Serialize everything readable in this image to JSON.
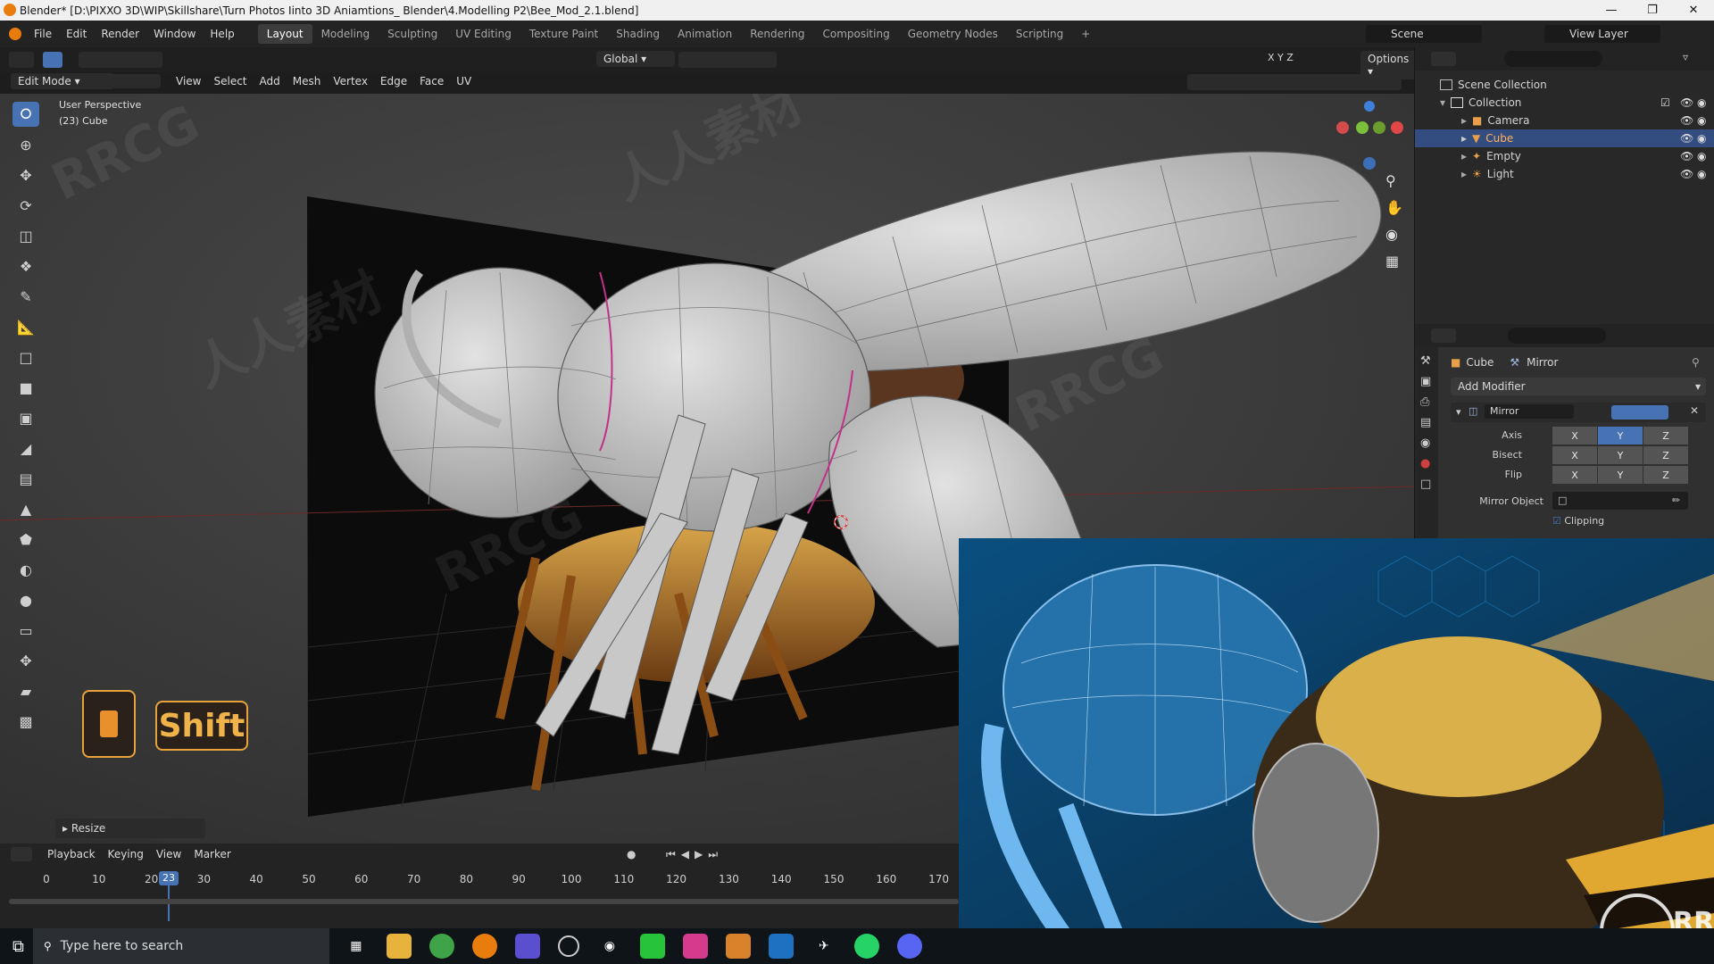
{
  "window": {
    "title": "Blender* [D:\\PIXXO 3D\\WIP\\Skillshare\\Turn Photos Iinto 3D Aniamtions_ Blender\\4.Modelling P2\\Bee_Mod_2.1.blend]"
  },
  "menubar": {
    "items": [
      "File",
      "Edit",
      "Render",
      "Window",
      "Help"
    ],
    "workspaces": [
      "Layout",
      "Modeling",
      "Sculpting",
      "UV Editing",
      "Texture Paint",
      "Shading",
      "Animation",
      "Rendering",
      "Compositing",
      "Geometry Nodes",
      "Scripting"
    ],
    "active_workspace": "Layout",
    "scene_label": "Scene",
    "view_layer_label": "View Layer"
  },
  "viewport_header": {
    "transform_orientation": "Global",
    "options_label": "Options",
    "mode": "Edit Mode",
    "menus": [
      "View",
      "Select",
      "Add",
      "Mesh",
      "Vertex",
      "Edge",
      "Face",
      "UV"
    ],
    "axis_x": "X",
    "axis_y": "Y",
    "axis_z": "Z"
  },
  "viewport": {
    "perspective": "User Perspective",
    "object_info": "(23) Cube",
    "gizmo_labels": {
      "x": "X",
      "y": "Y",
      "z": "Z"
    },
    "key_hint": "Shift",
    "operator_panel": "Resize"
  },
  "outliner": {
    "root": "Scene Collection",
    "collection": "Collection",
    "items": [
      {
        "label": "Camera",
        "selected": false
      },
      {
        "label": "Cube",
        "selected": true
      },
      {
        "label": "Empty",
        "selected": false
      },
      {
        "label": "Light",
        "selected": false
      }
    ]
  },
  "properties": {
    "object_name": "Cube",
    "modifier_breadcrumb": "Mirror",
    "add_modifier_label": "Add Modifier",
    "modifier_name": "Mirror",
    "rows": [
      {
        "label": "Axis",
        "x": "X",
        "y": "Y",
        "z": "Z",
        "active": "Y"
      },
      {
        "label": "Bisect",
        "x": "X",
        "y": "Y",
        "z": "Z",
        "active": ""
      },
      {
        "label": "Flip",
        "x": "X",
        "y": "Y",
        "z": "Z",
        "active": ""
      }
    ],
    "mirror_object_label": "Mirror Object",
    "clipping_label": "Clipping"
  },
  "timeline": {
    "menus": [
      "Playback",
      "Keying",
      "View",
      "Marker"
    ],
    "current_frame": "23",
    "ticks": [
      "0",
      "10",
      "20",
      "30",
      "40",
      "50",
      "60",
      "70",
      "80",
      "90",
      "100",
      "110",
      "120",
      "130",
      "140",
      "150",
      "160",
      "170"
    ]
  },
  "taskbar": {
    "search_placeholder": "Type here to search"
  },
  "watermarks": {
    "brand": "RRCG",
    "brand_cn": "人人素材"
  },
  "colors": {
    "accent": "#4772b3",
    "selected_row": "#334d80",
    "blender_orange": "#e87d0d",
    "key_hint": "#f0b34a"
  }
}
